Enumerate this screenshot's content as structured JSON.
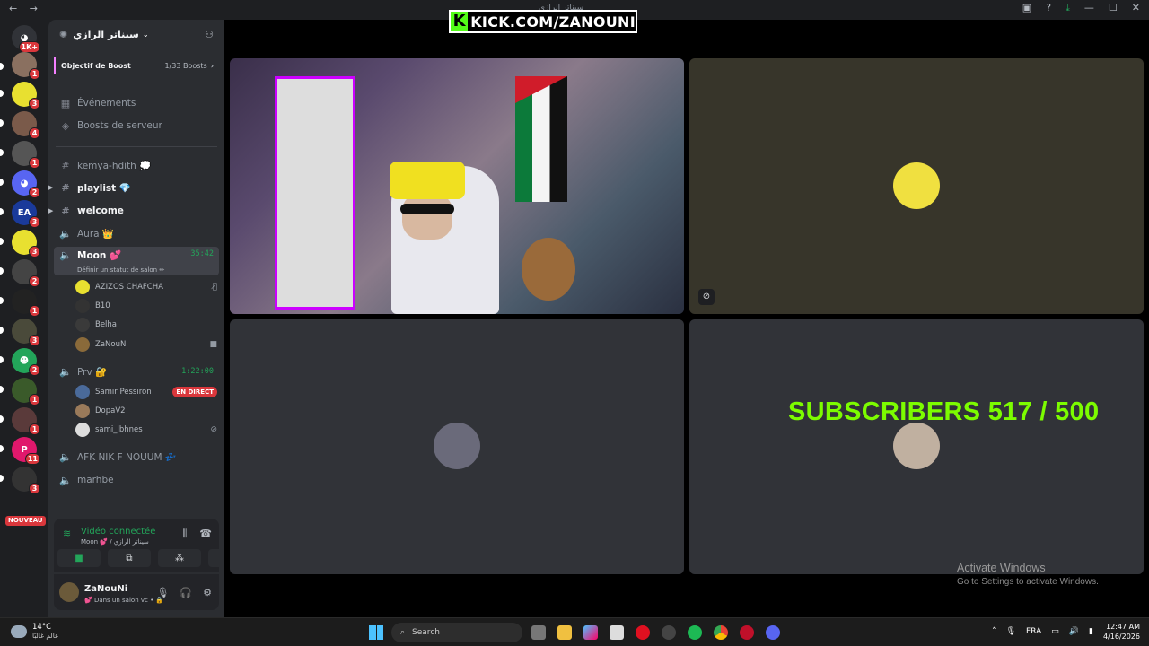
{
  "titlebar": {
    "back": "←",
    "forward": "→",
    "title": "سيناتر الرازي"
  },
  "overlay": {
    "kick_k": "K",
    "kick_text": "KICK.COM/ZANOUNI"
  },
  "rail": {
    "items": [
      {
        "badge": "1K+"
      },
      {
        "badge": "1"
      },
      {
        "badge": "3"
      },
      {
        "badge": "4"
      },
      {
        "badge": "1"
      },
      {
        "badge": "2"
      },
      {
        "badge": "3"
      },
      {
        "badge": "3"
      },
      {
        "badge": "2"
      },
      {
        "badge": "1"
      },
      {
        "badge": "3"
      },
      {
        "badge": "2"
      },
      {
        "badge": "1"
      },
      {
        "badge": "1"
      },
      {
        "badge": "11"
      },
      {
        "badge": "3"
      }
    ],
    "ea_label": "EA",
    "p_label": "P",
    "new_label": "NOUVEAU"
  },
  "server": {
    "name": "سيناتر الرازي",
    "boost_label": "Objectif de Boost",
    "boost_count": "1/33 Boosts",
    "events": "Événements",
    "server_boosts": "Boosts de serveur"
  },
  "channels": {
    "kemya": "kemya-hdith 💭",
    "playlist": "playlist 💎",
    "welcome": "welcome",
    "aura": "Aura 👑",
    "moon": "Moon 💕",
    "moon_time": "35:42",
    "moon_status": "Définir un statut de salon ✏",
    "moon_users": [
      "AZIZOS CHAFCHA",
      "B10",
      "Belha",
      "ZaNouNi"
    ],
    "prv": "Prv 🔐",
    "prv_time": "1:22:00",
    "prv_users": [
      "Samir Pessiron",
      "DopaV2",
      "sami_lbhnes"
    ],
    "live_badge": "EN DIRECT",
    "afk": "AFK NIK F NOUUM 💤",
    "marhbe": "marhbe"
  },
  "voice_panel": {
    "status": "Vidéo connectée",
    "location": "Moon 💕 / سيناتر الرازي"
  },
  "user_panel": {
    "name": "ZaNouNi",
    "status": "💕 Dans un salon vc • 🔒"
  },
  "stage": {
    "subs_text": "SUBSCRIBERS 517 / 500",
    "activate_title": "Activate Windows",
    "activate_sub": "Go to Settings to activate Windows."
  },
  "taskbar": {
    "temp": "14°C",
    "location": "عالم غالبًا",
    "search": "Search",
    "lang": "FRA",
    "time": "12:47 AM",
    "date": "4/16/2026"
  },
  "colors": {
    "accent": "#5865f2",
    "online": "#23a55a",
    "live": "#da373c",
    "subs": "#7cfc00"
  }
}
